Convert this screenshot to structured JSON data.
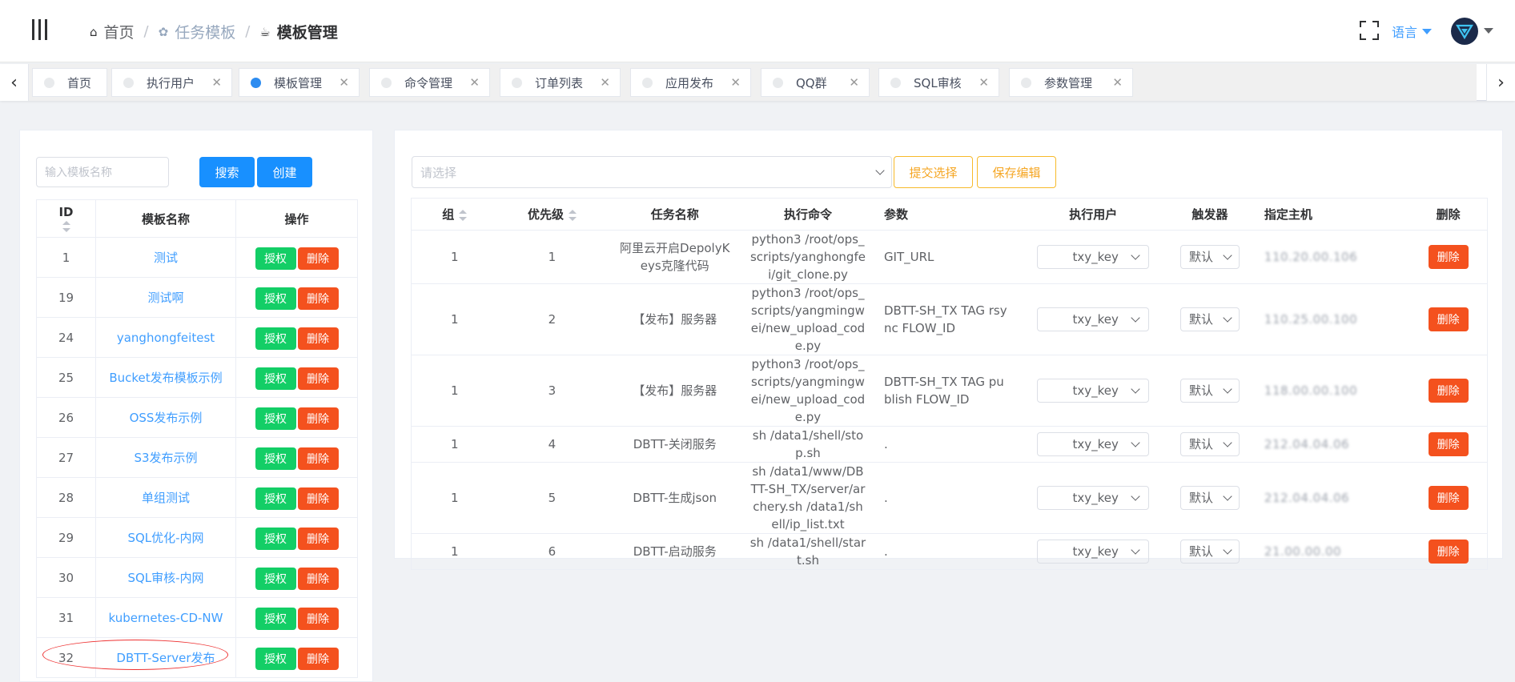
{
  "breadcrumb": {
    "home": "首页",
    "parent": "任务模板",
    "current": "模板管理"
  },
  "header": {
    "language": "语言"
  },
  "tabs": [
    {
      "label": "首页",
      "closable": false,
      "active": false
    },
    {
      "label": "执行用户",
      "closable": true,
      "active": false
    },
    {
      "label": "模板管理",
      "closable": true,
      "active": true
    },
    {
      "label": "命令管理",
      "closable": true,
      "active": false
    },
    {
      "label": "订单列表",
      "closable": true,
      "active": false
    },
    {
      "label": "应用发布",
      "closable": true,
      "active": false
    },
    {
      "label": "QQ群",
      "closable": true,
      "active": false
    },
    {
      "label": "SQL审核",
      "closable": true,
      "active": false
    },
    {
      "label": "参数管理",
      "closable": true,
      "active": false
    }
  ],
  "left": {
    "search_placeholder": "输入模板名称",
    "search_label": "搜索",
    "create_label": "创建",
    "columns": {
      "id": "ID",
      "name": "模板名称",
      "ops": "操作"
    },
    "auth_label": "授权",
    "delete_label": "删除",
    "rows": [
      {
        "id": "1",
        "name": "测试"
      },
      {
        "id": "19",
        "name": "测试啊"
      },
      {
        "id": "24",
        "name": "yanghongfeitest"
      },
      {
        "id": "25",
        "name": "Bucket发布模板示例"
      },
      {
        "id": "26",
        "name": "OSS发布示例"
      },
      {
        "id": "27",
        "name": "S3发布示例"
      },
      {
        "id": "28",
        "name": "单组测试"
      },
      {
        "id": "29",
        "name": "SQL优化-内网"
      },
      {
        "id": "30",
        "name": "SQL审核-内网"
      },
      {
        "id": "31",
        "name": "kubernetes-CD-NW"
      },
      {
        "id": "32",
        "name": "DBTT-Server发布"
      }
    ]
  },
  "right": {
    "select_placeholder": "请选择",
    "submit_label": "提交选择",
    "save_label": "保存编辑",
    "columns": {
      "group": "组",
      "priority": "优先级",
      "task": "任务名称",
      "command": "执行命令",
      "param": "参数",
      "user": "执行用户",
      "trigger": "触发器",
      "host": "指定主机",
      "delete": "删除"
    },
    "delete_label": "删除",
    "rows": [
      {
        "group": "1",
        "priority": "1",
        "task": "阿里云开启DepolyKeys克隆代码",
        "command": "python3 /root/ops_scripts/yanghongfei/git_clone.py",
        "param": "GIT_URL",
        "user": "txy_key",
        "trigger": "默认",
        "host": "110.20.00.106"
      },
      {
        "group": "1",
        "priority": "2",
        "task": "【发布】服务器",
        "command": "python3 /root/ops_scripts/yangmingwei/new_upload_code.py",
        "param": "DBTT-SH_TX TAG rsync FLOW_ID",
        "user": "txy_key",
        "trigger": "默认",
        "host": "110.25.00.100"
      },
      {
        "group": "1",
        "priority": "3",
        "task": "【发布】服务器",
        "command": "python3 /root/ops_scripts/yangmingwei/new_upload_code.py",
        "param": "DBTT-SH_TX TAG publish FLOW_ID",
        "user": "txy_key",
        "trigger": "默认",
        "host": "118.00.00.100"
      },
      {
        "group": "1",
        "priority": "4",
        "task": "DBTT-关闭服务",
        "command": "sh /data1/shell/stop.sh",
        "param": ".",
        "user": "txy_key",
        "trigger": "默认",
        "host": "212.04.04.06"
      },
      {
        "group": "1",
        "priority": "5",
        "task": "DBTT-生成json",
        "command": "sh /data1/www/DBTT-SH_TX/server/archery.sh /data1/shell/ip_list.txt",
        "param": ".",
        "user": "txy_key",
        "trigger": "默认",
        "host": "212.04.04.06"
      },
      {
        "group": "1",
        "priority": "6",
        "task": "DBTT-启动服务",
        "command": "sh /data1/shell/start.sh",
        "param": ".",
        "user": "txy_key",
        "trigger": "默认",
        "host": "21.00.00.00"
      }
    ]
  },
  "colors": {
    "primary": "#1890ff",
    "success": "#13ce66",
    "danger": "#f4511e",
    "warning": "#f5a623",
    "link": "#409eff"
  }
}
